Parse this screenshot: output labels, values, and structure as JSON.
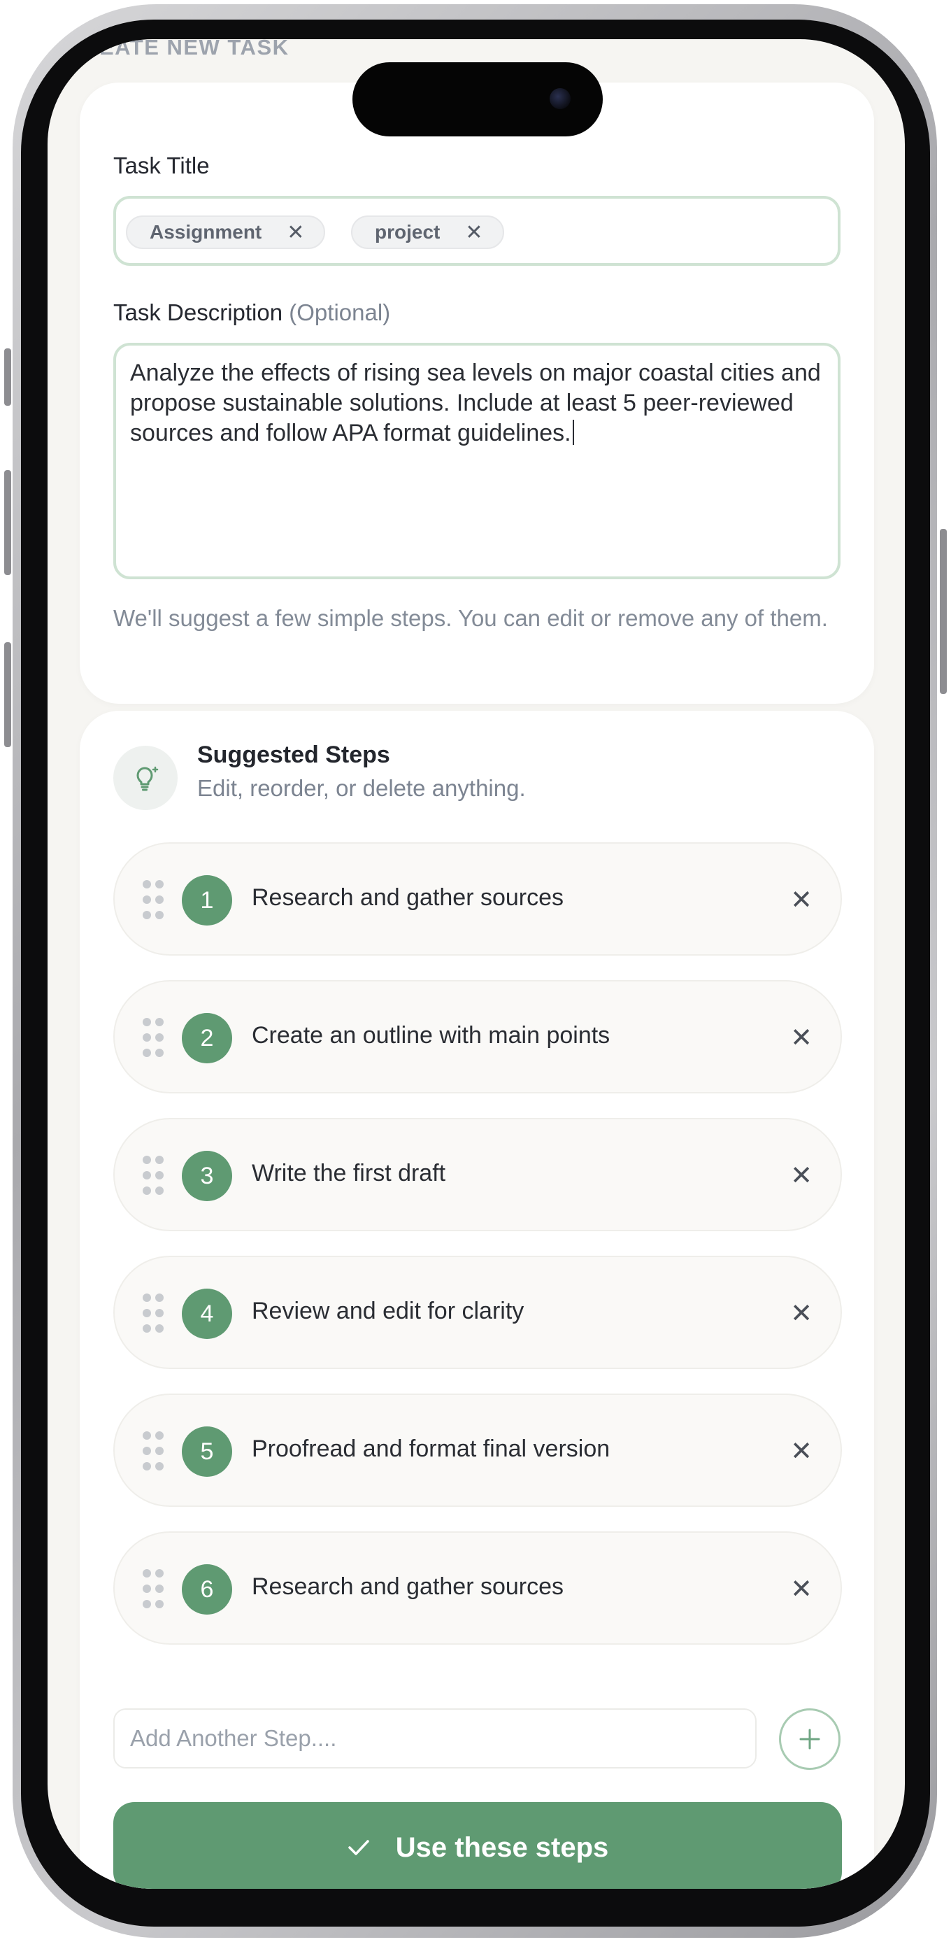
{
  "header": {
    "title": "EATE NEW TASK"
  },
  "form": {
    "title_label": "Task Title",
    "tags": [
      "Assignment",
      "project"
    ],
    "description_label": "Task Description",
    "description_optional": "(Optional)",
    "description_value": "Analyze the effects of rising sea levels on major coastal cities and propose sustainable solutions. Include at least 5 peer-reviewed sources and follow APA format guidelines.",
    "hint": "We'll suggest a few simple steps. You can edit or remove any of them."
  },
  "steps": {
    "title": "Suggested Steps",
    "subtitle": "Edit, reorder, or delete anything.",
    "items": [
      {
        "number": "1",
        "text": "Research and gather sources"
      },
      {
        "number": "2",
        "text": "Create an outline with main points"
      },
      {
        "number": "3",
        "text": "Write the first draft"
      },
      {
        "number": "4",
        "text": "Review and edit for clarity"
      },
      {
        "number": "5",
        "text": "Proofread and format final version"
      },
      {
        "number": "6",
        "text": "Research and gather sources"
      }
    ],
    "add_placeholder": "Add Another Step....",
    "submit_label": "Use these steps"
  },
  "icons": {
    "remove": "close-icon",
    "tag_remove": "close-icon",
    "drag": "drag-handle-icon",
    "header": "lightbulb-icon",
    "add": "plus-icon",
    "submit": "check-icon"
  },
  "colors": {
    "accent": "#5f9a72",
    "field_border": "#cfe3d3",
    "background": "#f6f5f2"
  }
}
